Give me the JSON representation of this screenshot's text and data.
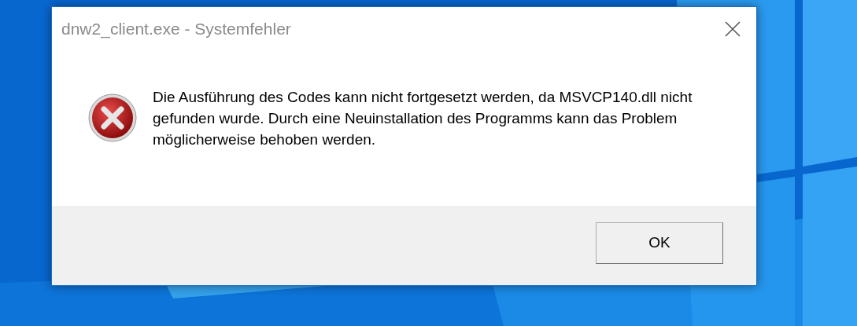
{
  "window": {
    "title": "dnw2_client.exe - Systemfehler"
  },
  "message": {
    "text": "Die Ausführung des Codes kann nicht fortgesetzt werden, da MSVCP140.dll nicht gefunden wurde. Durch eine Neuinstallation des Programms kann das Problem möglicherweise behoben werden."
  },
  "buttons": [
    "OK"
  ]
}
